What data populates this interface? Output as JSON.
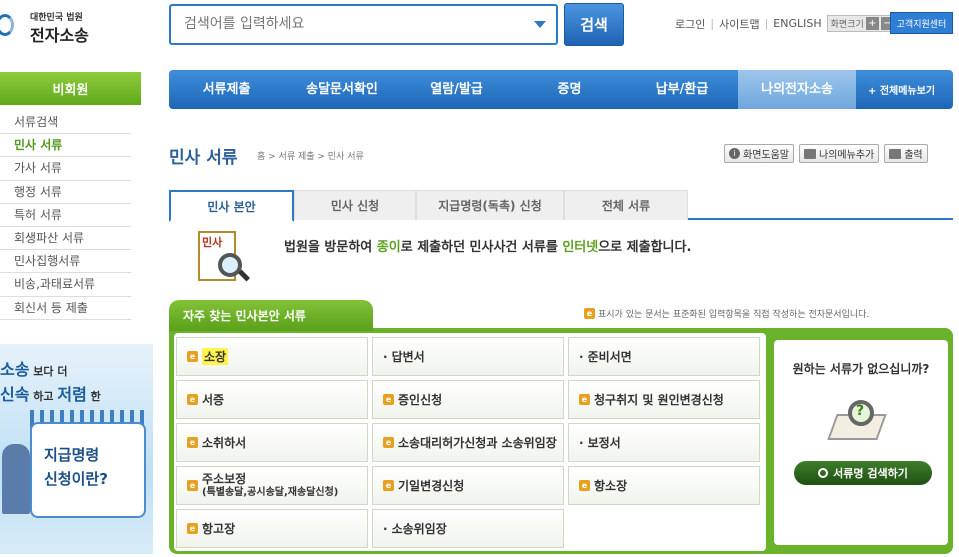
{
  "logo": {
    "line1": "대한민국 법원",
    "line2": "전자소송"
  },
  "search": {
    "placeholder": "검색어를 입력하세요",
    "button": "검색"
  },
  "toplinks": {
    "login": "로그인",
    "sitemap": "사이트맵",
    "english": "ENGLISH",
    "fontsize": "화면크기",
    "plus": "+",
    "minus": "−",
    "center": "고객지원센터"
  },
  "nav": {
    "items": [
      "서류제출",
      "송달문서확인",
      "열람/발급",
      "증명",
      "납부/환급",
      "나의전자소송"
    ],
    "all": "+ 전체메뉴보기"
  },
  "sidebar": {
    "header": "비회원",
    "items": [
      "서류검색",
      "민사 서류",
      "가사 서류",
      "행정 서류",
      "특허 서류",
      "회생파산 서류",
      "민사집행서류",
      "비송,과태료서류",
      "회신서 등 제출"
    ]
  },
  "promo": {
    "l1a": "소송",
    "l1b": " 보다 더",
    "l2a": "신속",
    "l2b": " 하고 ",
    "l2c": "저렴",
    "l2d": " 한",
    "c1": "지급명령",
    "c2": "신청이란?"
  },
  "page": {
    "title": "민사 서류",
    "breadcrumb": "홈 > 서류 제출 > 민사 서류"
  },
  "tools": {
    "help": "화면도움말",
    "mymenu": "나의메뉴추가",
    "print": "출력"
  },
  "tabs": [
    "민사 본안",
    "민사 신청",
    "지급명령(독촉) 신청",
    "전체 서류"
  ],
  "intro": {
    "icon_label": "민사",
    "p1": "법원을 방문하여 ",
    "g1": "종이",
    "p2": "로 제출하던 민사사건 서류를 ",
    "g2": "인터넷",
    "p3": "으로 제출합니다."
  },
  "section": {
    "title": "자주 찾는 민사본안 서류",
    "note": "표시가 있는 문서는 표준화된 입력항목을 직접 작성하는 전자문서입니다."
  },
  "forms": {
    "c0": "소장",
    "c1": "답변서",
    "c2": "준비서면",
    "c3": "서증",
    "c4": "증인신청",
    "c5": "청구취지 및 원인변경신청",
    "c6": "소취하서",
    "c7": "소송대리허가신청과 소송위임장",
    "c8": "보정서",
    "c9a": "주소보정",
    "c9b": "(특별송달,공시송달,재송달신청)",
    "c10": "기일변경신청",
    "c11": "항소장",
    "c12": "항고장",
    "c13": "소송위임장"
  },
  "right": {
    "question": "원하는 서류가 없으십니까?",
    "button": "서류명 검색하기",
    "icon_label": "?"
  },
  "colors": {
    "accent_blue": "#1d66b6",
    "green": "#6ab22a",
    "highlight": "#fff34d"
  }
}
